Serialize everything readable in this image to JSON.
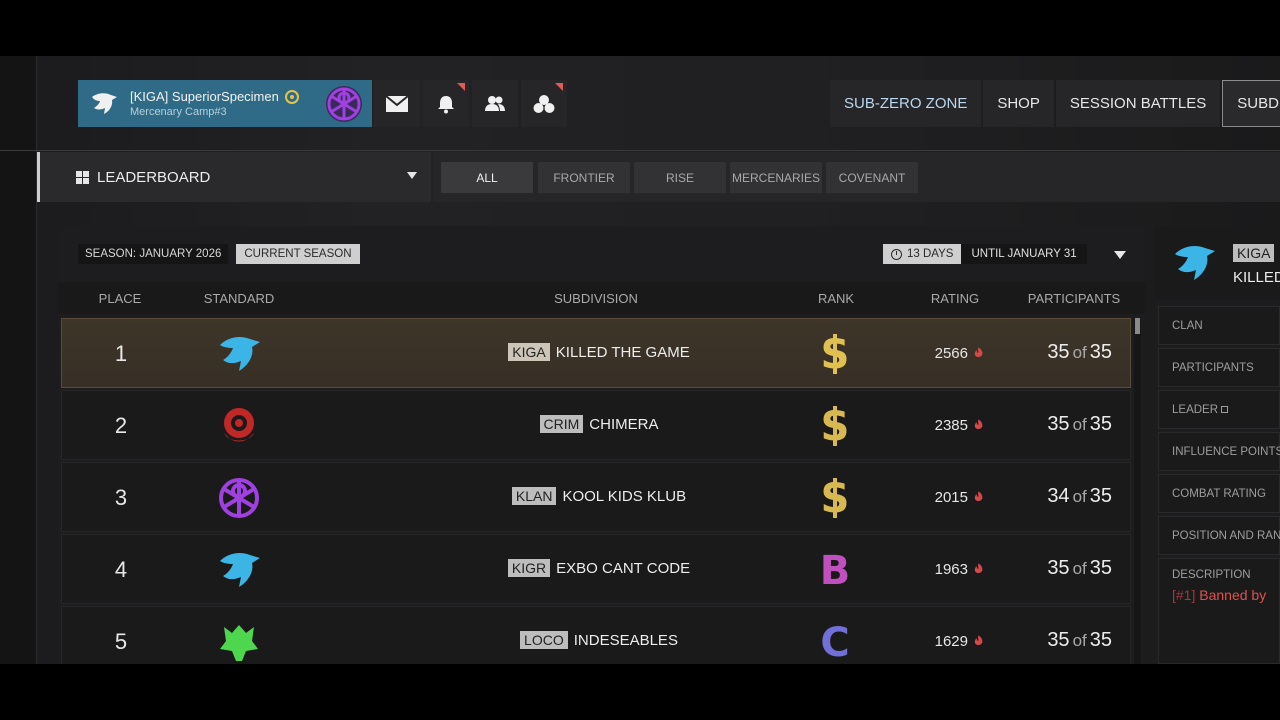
{
  "profile": {
    "player_name": "[KIGA] SuperiorSpecimen",
    "camp": "Mercenary Camp#3"
  },
  "icons": {
    "mail": "mail-icon",
    "bell": "bell-icon",
    "friends": "friends-icon",
    "group": "group-icon"
  },
  "topnav": [
    "SUB-ZERO ZONE",
    "SHOP",
    "SESSION BATTLES",
    "SUBDIVI"
  ],
  "leaderboard": {
    "selector_label": "LEADERBOARD",
    "filters": [
      "ALL",
      "FRONTIER",
      "RISE",
      "MERCENARIES",
      "COVENANT"
    ],
    "active_filter": "ALL"
  },
  "season": {
    "label": "SEASON: JANUARY 2026",
    "tag": "CURRENT SEASON",
    "days_left": "13 DAYS",
    "until": "UNTIL JANUARY 31"
  },
  "table": {
    "columns": [
      "PLACE",
      "STANDARD",
      "SUBDIVISION",
      "RANK",
      "RATING",
      "PARTICIPANTS"
    ],
    "of_word": "of",
    "rows": [
      {
        "place": "1",
        "tag": "KIGA",
        "name": "KILLED THE GAME",
        "rank": "S",
        "rating": "2566",
        "participants": "35",
        "max": "35",
        "emblem": "eagle-blue",
        "rank_color": "#e0c050"
      },
      {
        "place": "2",
        "tag": "CRIM",
        "name": "CHIMERA",
        "rank": "S",
        "rating": "2385",
        "participants": "35",
        "max": "35",
        "emblem": "crest-red",
        "rank_color": "#d8b850"
      },
      {
        "place": "3",
        "tag": "KLAN",
        "name": "KOOL KIDS KLUB",
        "rank": "S",
        "rating": "2015",
        "participants": "34",
        "max": "35",
        "emblem": "wheel-purple",
        "rank_color": "#d8b850"
      },
      {
        "place": "4",
        "tag": "KIGR",
        "name": "EXBO CANT CODE",
        "rank": "B",
        "rating": "1963",
        "participants": "35",
        "max": "35",
        "emblem": "eagle-blue",
        "rank_color": "#c050c0"
      },
      {
        "place": "5",
        "tag": "LOCO",
        "name": "INDESEABLES",
        "rank": "C",
        "rating": "1629",
        "participants": "35",
        "max": "35",
        "emblem": "wolf-green",
        "rank_color": "#7070d8"
      }
    ]
  },
  "detail": {
    "tag": "KIGA",
    "name": "KILLED",
    "fields": [
      "CLAN",
      "PARTICIPANTS",
      "LEADER",
      "INFLUENCE POINTS",
      "COMBAT RATING",
      "POSITION AND RANK"
    ],
    "description_label": "DESCRIPTION",
    "description_index": "[#1]",
    "description_text": "Banned by"
  },
  "colors": {
    "profile_bg": "#2f6b86",
    "first_row": "#3e3529",
    "notification": "#e05a5a",
    "banned": "#e05050"
  }
}
